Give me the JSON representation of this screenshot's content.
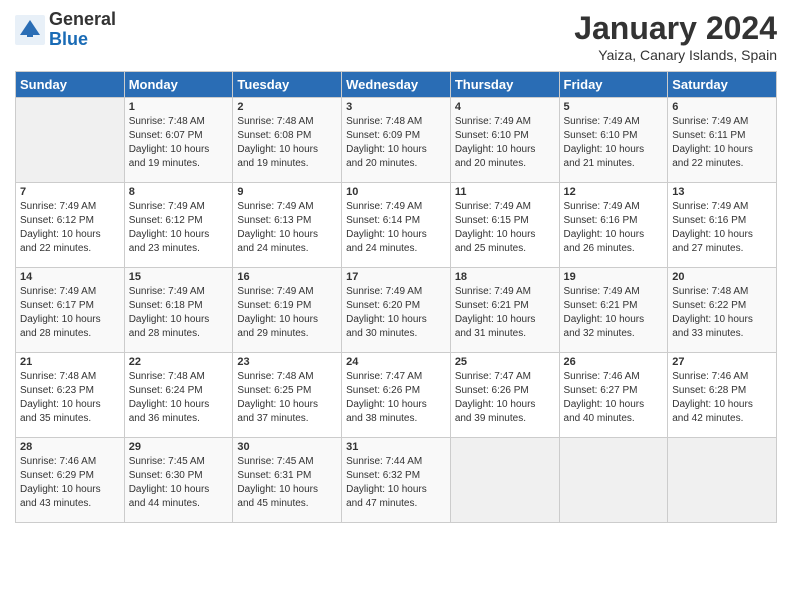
{
  "logo": {
    "general": "General",
    "blue": "Blue"
  },
  "title": "January 2024",
  "subtitle": "Yaiza, Canary Islands, Spain",
  "days_of_week": [
    "Sunday",
    "Monday",
    "Tuesday",
    "Wednesday",
    "Thursday",
    "Friday",
    "Saturday"
  ],
  "weeks": [
    [
      {
        "day": "",
        "sunrise": "",
        "sunset": "",
        "daylight": ""
      },
      {
        "day": "1",
        "sunrise": "Sunrise: 7:48 AM",
        "sunset": "Sunset: 6:07 PM",
        "daylight": "Daylight: 10 hours and 19 minutes."
      },
      {
        "day": "2",
        "sunrise": "Sunrise: 7:48 AM",
        "sunset": "Sunset: 6:08 PM",
        "daylight": "Daylight: 10 hours and 19 minutes."
      },
      {
        "day": "3",
        "sunrise": "Sunrise: 7:48 AM",
        "sunset": "Sunset: 6:09 PM",
        "daylight": "Daylight: 10 hours and 20 minutes."
      },
      {
        "day": "4",
        "sunrise": "Sunrise: 7:49 AM",
        "sunset": "Sunset: 6:10 PM",
        "daylight": "Daylight: 10 hours and 20 minutes."
      },
      {
        "day": "5",
        "sunrise": "Sunrise: 7:49 AM",
        "sunset": "Sunset: 6:10 PM",
        "daylight": "Daylight: 10 hours and 21 minutes."
      },
      {
        "day": "6",
        "sunrise": "Sunrise: 7:49 AM",
        "sunset": "Sunset: 6:11 PM",
        "daylight": "Daylight: 10 hours and 22 minutes."
      }
    ],
    [
      {
        "day": "7",
        "sunrise": "Sunrise: 7:49 AM",
        "sunset": "Sunset: 6:12 PM",
        "daylight": "Daylight: 10 hours and 22 minutes."
      },
      {
        "day": "8",
        "sunrise": "Sunrise: 7:49 AM",
        "sunset": "Sunset: 6:12 PM",
        "daylight": "Daylight: 10 hours and 23 minutes."
      },
      {
        "day": "9",
        "sunrise": "Sunrise: 7:49 AM",
        "sunset": "Sunset: 6:13 PM",
        "daylight": "Daylight: 10 hours and 24 minutes."
      },
      {
        "day": "10",
        "sunrise": "Sunrise: 7:49 AM",
        "sunset": "Sunset: 6:14 PM",
        "daylight": "Daylight: 10 hours and 24 minutes."
      },
      {
        "day": "11",
        "sunrise": "Sunrise: 7:49 AM",
        "sunset": "Sunset: 6:15 PM",
        "daylight": "Daylight: 10 hours and 25 minutes."
      },
      {
        "day": "12",
        "sunrise": "Sunrise: 7:49 AM",
        "sunset": "Sunset: 6:16 PM",
        "daylight": "Daylight: 10 hours and 26 minutes."
      },
      {
        "day": "13",
        "sunrise": "Sunrise: 7:49 AM",
        "sunset": "Sunset: 6:16 PM",
        "daylight": "Daylight: 10 hours and 27 minutes."
      }
    ],
    [
      {
        "day": "14",
        "sunrise": "Sunrise: 7:49 AM",
        "sunset": "Sunset: 6:17 PM",
        "daylight": "Daylight: 10 hours and 28 minutes."
      },
      {
        "day": "15",
        "sunrise": "Sunrise: 7:49 AM",
        "sunset": "Sunset: 6:18 PM",
        "daylight": "Daylight: 10 hours and 28 minutes."
      },
      {
        "day": "16",
        "sunrise": "Sunrise: 7:49 AM",
        "sunset": "Sunset: 6:19 PM",
        "daylight": "Daylight: 10 hours and 29 minutes."
      },
      {
        "day": "17",
        "sunrise": "Sunrise: 7:49 AM",
        "sunset": "Sunset: 6:20 PM",
        "daylight": "Daylight: 10 hours and 30 minutes."
      },
      {
        "day": "18",
        "sunrise": "Sunrise: 7:49 AM",
        "sunset": "Sunset: 6:21 PM",
        "daylight": "Daylight: 10 hours and 31 minutes."
      },
      {
        "day": "19",
        "sunrise": "Sunrise: 7:49 AM",
        "sunset": "Sunset: 6:21 PM",
        "daylight": "Daylight: 10 hours and 32 minutes."
      },
      {
        "day": "20",
        "sunrise": "Sunrise: 7:48 AM",
        "sunset": "Sunset: 6:22 PM",
        "daylight": "Daylight: 10 hours and 33 minutes."
      }
    ],
    [
      {
        "day": "21",
        "sunrise": "Sunrise: 7:48 AM",
        "sunset": "Sunset: 6:23 PM",
        "daylight": "Daylight: 10 hours and 35 minutes."
      },
      {
        "day": "22",
        "sunrise": "Sunrise: 7:48 AM",
        "sunset": "Sunset: 6:24 PM",
        "daylight": "Daylight: 10 hours and 36 minutes."
      },
      {
        "day": "23",
        "sunrise": "Sunrise: 7:48 AM",
        "sunset": "Sunset: 6:25 PM",
        "daylight": "Daylight: 10 hours and 37 minutes."
      },
      {
        "day": "24",
        "sunrise": "Sunrise: 7:47 AM",
        "sunset": "Sunset: 6:26 PM",
        "daylight": "Daylight: 10 hours and 38 minutes."
      },
      {
        "day": "25",
        "sunrise": "Sunrise: 7:47 AM",
        "sunset": "Sunset: 6:26 PM",
        "daylight": "Daylight: 10 hours and 39 minutes."
      },
      {
        "day": "26",
        "sunrise": "Sunrise: 7:46 AM",
        "sunset": "Sunset: 6:27 PM",
        "daylight": "Daylight: 10 hours and 40 minutes."
      },
      {
        "day": "27",
        "sunrise": "Sunrise: 7:46 AM",
        "sunset": "Sunset: 6:28 PM",
        "daylight": "Daylight: 10 hours and 42 minutes."
      }
    ],
    [
      {
        "day": "28",
        "sunrise": "Sunrise: 7:46 AM",
        "sunset": "Sunset: 6:29 PM",
        "daylight": "Daylight: 10 hours and 43 minutes."
      },
      {
        "day": "29",
        "sunrise": "Sunrise: 7:45 AM",
        "sunset": "Sunset: 6:30 PM",
        "daylight": "Daylight: 10 hours and 44 minutes."
      },
      {
        "day": "30",
        "sunrise": "Sunrise: 7:45 AM",
        "sunset": "Sunset: 6:31 PM",
        "daylight": "Daylight: 10 hours and 45 minutes."
      },
      {
        "day": "31",
        "sunrise": "Sunrise: 7:44 AM",
        "sunset": "Sunset: 6:32 PM",
        "daylight": "Daylight: 10 hours and 47 minutes."
      },
      {
        "day": "",
        "sunrise": "",
        "sunset": "",
        "daylight": ""
      },
      {
        "day": "",
        "sunrise": "",
        "sunset": "",
        "daylight": ""
      },
      {
        "day": "",
        "sunrise": "",
        "sunset": "",
        "daylight": ""
      }
    ]
  ]
}
